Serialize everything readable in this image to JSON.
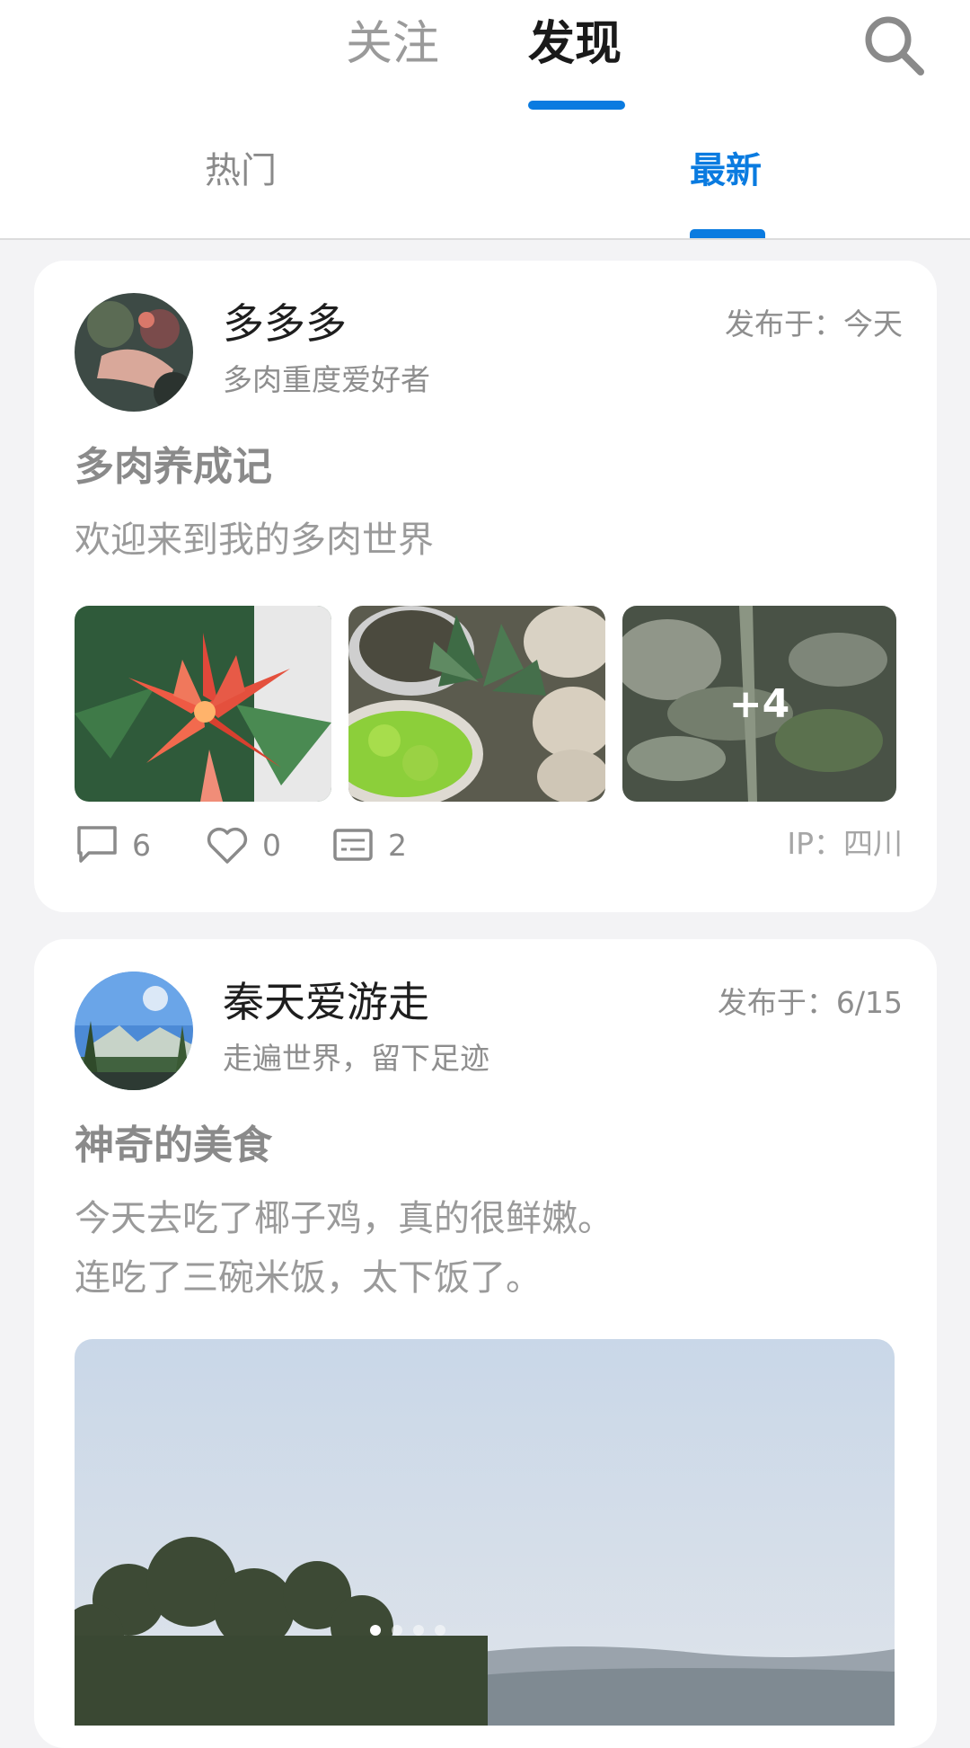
{
  "header": {
    "tabs": [
      {
        "label": "关注",
        "active": false
      },
      {
        "label": "发现",
        "active": true
      }
    ],
    "search_icon": "search-icon",
    "sub_tabs": [
      {
        "label": "热门",
        "active": false
      },
      {
        "label": "最新",
        "active": true
      }
    ],
    "accent_color": "#0a7be0"
  },
  "posts": [
    {
      "username": "多多多",
      "bio": "多肉重度爱好者",
      "published": "发布于：今天",
      "title": "多肉养成记",
      "body_lines": [
        "欢迎来到我的多肉世界"
      ],
      "more_images": "+4",
      "comments": "6",
      "likes": "0",
      "messages": "2",
      "ip": "IP：四川"
    },
    {
      "username": "秦天爱游走",
      "bio": "走遍世界，留下足迹",
      "published": "发布于：6/15",
      "title": "神奇的美食",
      "body_lines": [
        "今天去吃了椰子鸡，真的很鲜嫩。",
        "连吃了三碗米饭，太下饭了。"
      ],
      "image_carousel": {
        "total": 4,
        "current": 1
      }
    }
  ]
}
